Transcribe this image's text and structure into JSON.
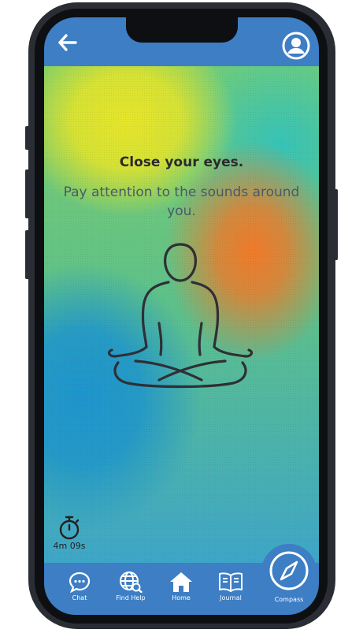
{
  "header": {
    "back_icon": "arrow-left-icon",
    "profile_icon": "user-circle-icon"
  },
  "main": {
    "title": "Close your eyes.",
    "subtitle": "Pay attention to the sounds around you.",
    "illustration_icon": "meditation-figure-icon"
  },
  "timer": {
    "icon": "stopwatch-icon",
    "value": "4m 09s"
  },
  "nav": {
    "items": [
      {
        "label": "Chat",
        "icon": "chat-bubble-icon"
      },
      {
        "label": "Find Help",
        "icon": "globe-search-icon"
      },
      {
        "label": "Home",
        "icon": "home-icon"
      },
      {
        "label": "Journal",
        "icon": "book-icon"
      },
      {
        "label": "Compass",
        "icon": "compass-icon"
      }
    ]
  },
  "colors": {
    "bar_blue": "#3d7ec4",
    "title": "#2b2b2b",
    "subtitle": "#4a5a66"
  }
}
